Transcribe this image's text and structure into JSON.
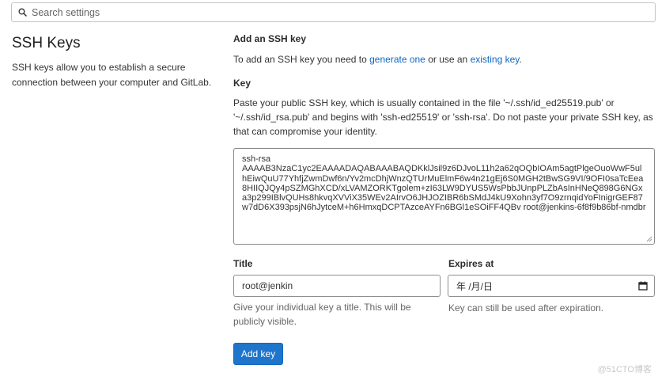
{
  "search": {
    "placeholder": "Search settings"
  },
  "section": {
    "title": "SSH Keys",
    "description": "SSH keys allow you to establish a secure connection between your computer and GitLab."
  },
  "form": {
    "heading": "Add an SSH key",
    "intro_prefix": "To add an SSH key you need to ",
    "intro_link1": "generate one",
    "intro_middle": " or use an ",
    "intro_link2": "existing key",
    "intro_suffix": ".",
    "key_label": "Key",
    "key_help": "Paste your public SSH key, which is usually contained in the file '~/.ssh/id_ed25519.pub' or '~/.ssh/id_rsa.pub' and begins with 'ssh-ed25519' or 'ssh-rsa'. Do not paste your private SSH key, as that can compromise your identity.",
    "key_line1": "ssh-rsa",
    "key_value": "AAAAB3NzaC1yc2EAAAADAQABAAABAQDKklJsil9z6DJvoL11h2a62qOQbIOAm5agtPlgeOuoWwF5ulhEiwQuU77YhfjZwmDwf6n/Yv2mcDhjWnzQTUrMuElmF6w4n21gEj6S0MGH2tBwSG9VI/9OFI0saTcEea8HIIQJQy4pSZMGhXCD/xLVAMZORKTgolem+zI63LW9DYUS5WsPbbJUnpPLZbAsInHNeQ898G6NGxa3p299IBlvQUHs8hkvqXVViX35WEv2AIrvO6JHJOZIBR6bSMdJ4kU9Xohn3yf7O9zrnqidYoFInigrGEF87w7dD6X393psjN6hJytceM+h6HmxqDCPTAzceAYFn6BGl1eSOiFF4QBv root@jenkins-6f8f9b86bf-nmdbr",
    "title_label": "Title",
    "title_value": "root@jenkin",
    "title_help": "Give your individual key a title. This will be publicly visible.",
    "expires_label": "Expires at",
    "expires_value": "年 /月/日",
    "expires_help": "Key can still be used after expiration.",
    "submit_label": "Add key"
  },
  "watermark": "@51CTO博客",
  "colors": {
    "primary": "#1f75cb",
    "link": "#1068bf"
  }
}
